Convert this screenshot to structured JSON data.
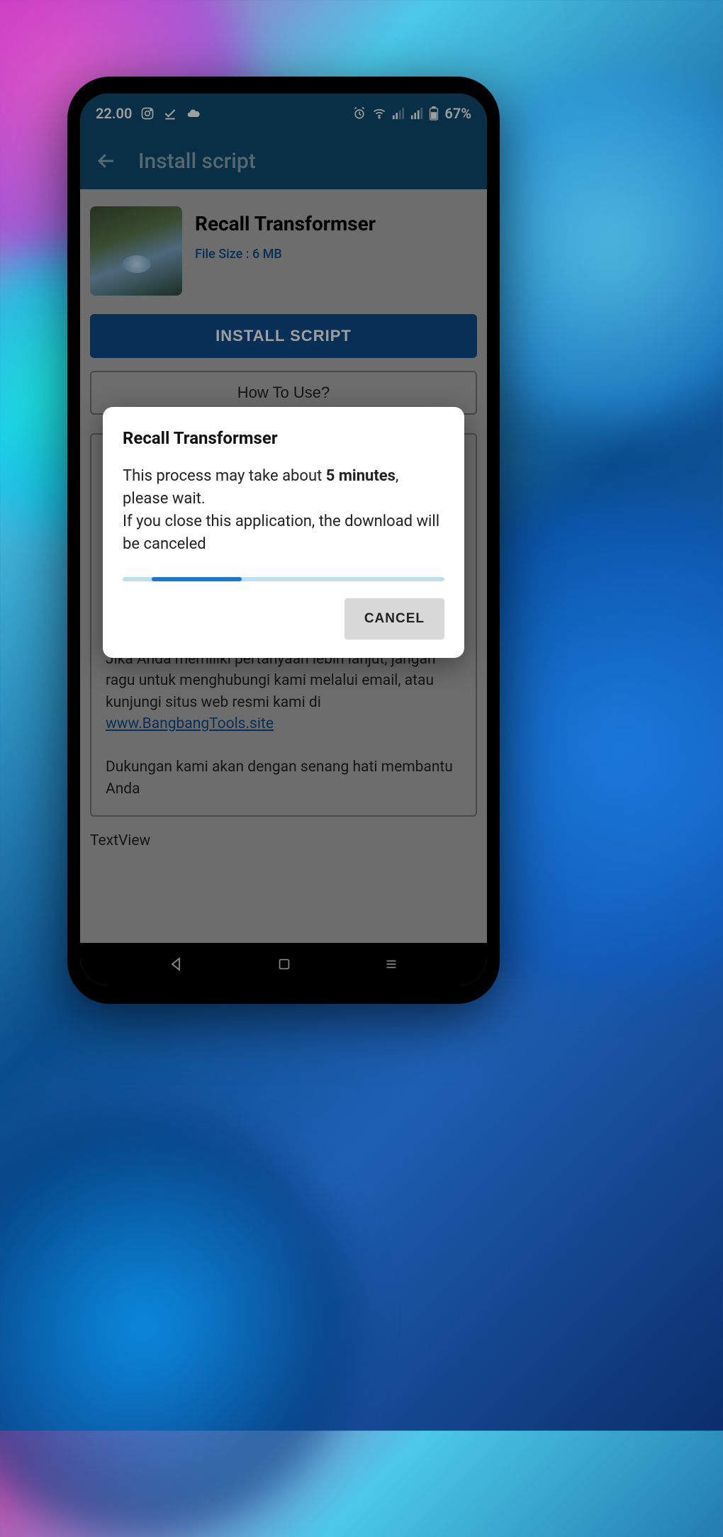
{
  "status_bar": {
    "time": "22.00",
    "battery": "67%"
  },
  "header": {
    "title": "Install script"
  },
  "item": {
    "title": "Recall Transformser",
    "file_size": "File Size : 6 MB"
  },
  "buttons": {
    "install": "INSTALL SCRIPT",
    "how_to_use": "How To Use?"
  },
  "info": {
    "paragraph1": "Jika Anda memiliki pertanyaan lebih lanjut, jangan ragu untuk menghubungi kami melalui email, atau kunjungi situs web resmi kami di",
    "link": "www.BangbangTools.site",
    "paragraph2": "Dukungan kami akan dengan senang hati membantu Anda"
  },
  "textview": "TextView",
  "dialog": {
    "title": "Recall Transformser",
    "line1_pre": "This process may take about ",
    "line1_bold": "5 minutes",
    "line1_post": ", please wait.",
    "line2": "If you close this application, the download will be canceled",
    "cancel": "CANCEL"
  }
}
